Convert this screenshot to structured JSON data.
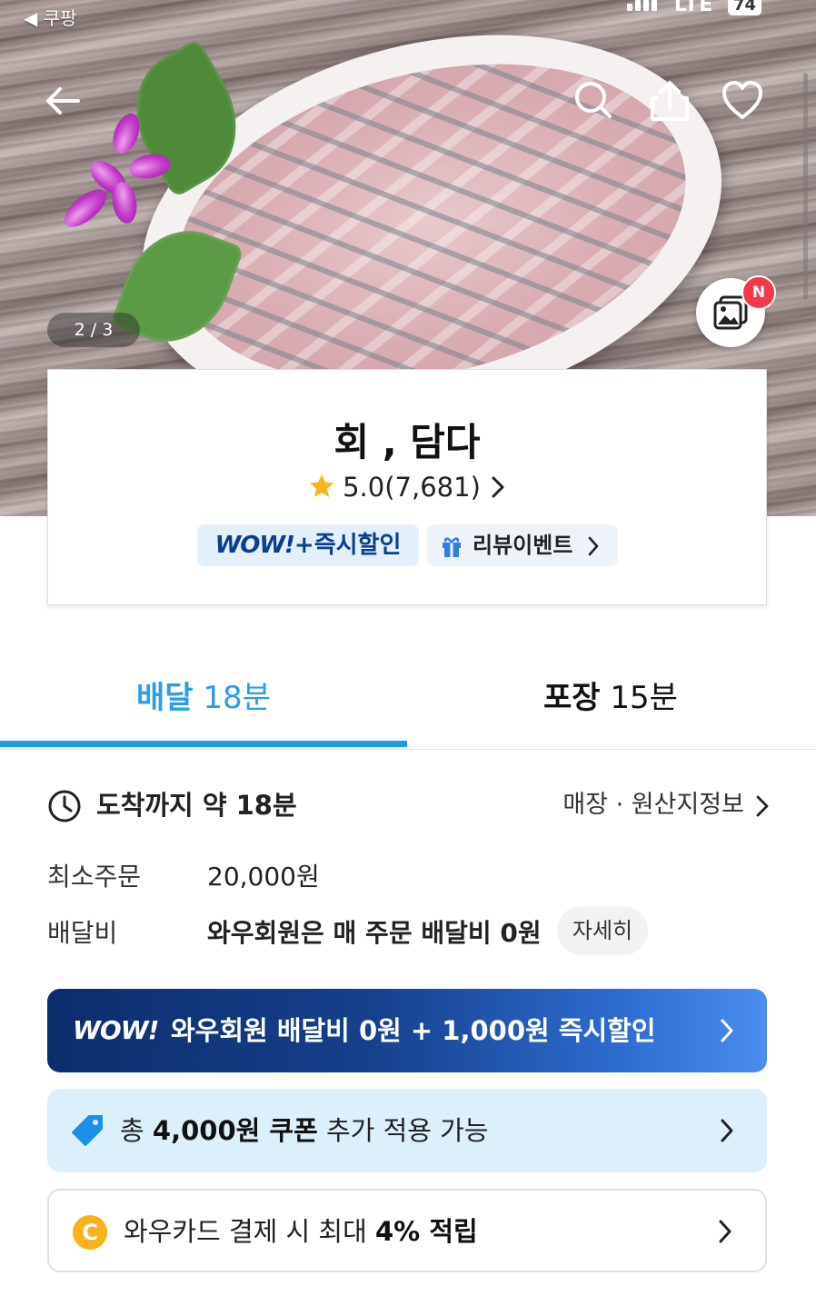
{
  "status_bar": {
    "back_app_label": "◀ 쿠팡",
    "network": "LTE",
    "battery": "74"
  },
  "hero": {
    "image_counter": "2 / 3",
    "gallery_badge": "N"
  },
  "store": {
    "name": "회 , 담다",
    "rating": "5.0(7,681)",
    "wow_badge_logo": "WOW!",
    "wow_badge_text": "+즉시할인",
    "review_event_label": "리뷰이벤트"
  },
  "tabs": [
    {
      "label": "배달",
      "time": "18분",
      "active": true
    },
    {
      "label": "포장",
      "time": "15분",
      "active": false
    }
  ],
  "delivery_info": {
    "eta": "도착까지 약 18분",
    "store_info_link": "매장 · 원산지정보",
    "min_order_label": "최소주문",
    "min_order_value": "20,000원",
    "fee_label": "배달비",
    "fee_value": "와우회원은 매 주문 배달비 0원",
    "detail_button": "자세히"
  },
  "promos": {
    "wow_logo": "WOW!",
    "wow_text": "와우회원 배달비 0원 + 1,000원 즉시할인",
    "coupon_prefix": "총 ",
    "coupon_amount": "4,000원 쿠폰",
    "coupon_suffix": " 추가 적용 가능",
    "card_coin": "C",
    "card_prefix": "와우카드 결제 시 최대 ",
    "card_rate": "4% 적립"
  },
  "colors": {
    "accent_blue": "#1f9bea",
    "wow_navy": "#0c2d6b",
    "coupon_bg": "#dcf0fc",
    "coin_yellow": "#f9b11c",
    "new_badge_red": "#f2394a"
  },
  "icons": [
    "back-arrow-icon",
    "search-icon",
    "share-icon",
    "heart-icon",
    "photo-gallery-icon",
    "star-icon",
    "gift-icon",
    "chevron-right-icon",
    "clock-icon",
    "coupon-tag-icon",
    "coin-icon"
  ]
}
